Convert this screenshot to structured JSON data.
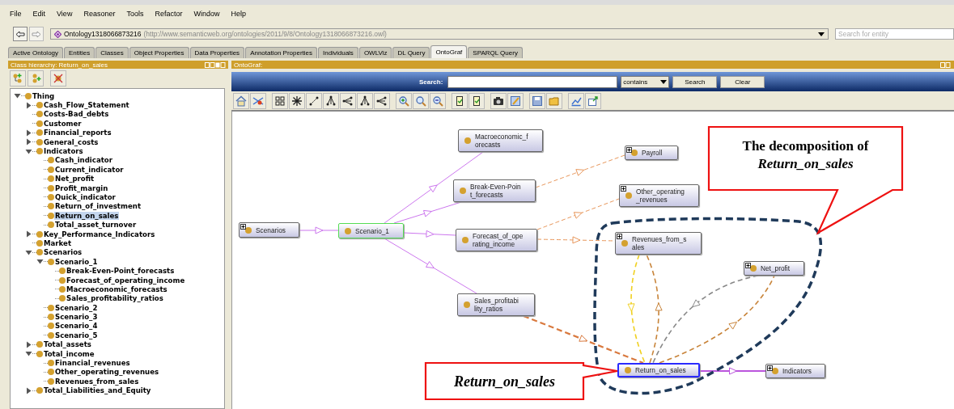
{
  "menu": [
    "File",
    "Edit",
    "View",
    "Reasoner",
    "Tools",
    "Refactor",
    "Window",
    "Help"
  ],
  "address": {
    "ontology": "Ontology1318066873216",
    "iri": "(http://www.semanticweb.org/ontologies/2011/9/8/Ontology1318066873216.owl)"
  },
  "entity_search": {
    "placeholder": "Search for entity"
  },
  "tabs": [
    {
      "label": "Active Ontology",
      "selected": false
    },
    {
      "label": "Entities",
      "selected": false
    },
    {
      "label": "Classes",
      "selected": false
    },
    {
      "label": "Object Properties",
      "selected": false
    },
    {
      "label": "Data Properties",
      "selected": false
    },
    {
      "label": "Annotation Properties",
      "selected": false
    },
    {
      "label": "Individuals",
      "selected": false
    },
    {
      "label": "OWLViz",
      "selected": false
    },
    {
      "label": "DL Query",
      "selected": false
    },
    {
      "label": "OntoGraf",
      "selected": true
    },
    {
      "label": "SPARQL Query",
      "selected": false
    }
  ],
  "class_hierarchy": {
    "title": "Class hierarchy: Return_on_sales",
    "tree": [
      {
        "label": "Thing",
        "expanded": true,
        "selected": false,
        "children": [
          {
            "label": "Cash_Flow_Statement",
            "expanded": false,
            "selected": false
          },
          {
            "label": "Costs-Bad_debts",
            "selected": false
          },
          {
            "label": "Customer",
            "selected": false
          },
          {
            "label": "Financial_reports",
            "expanded": false,
            "selected": false
          },
          {
            "label": "General_costs",
            "expanded": false,
            "selected": false
          },
          {
            "label": "Indicators",
            "expanded": true,
            "selected": false,
            "children": [
              {
                "label": "Cash_indicator",
                "selected": false
              },
              {
                "label": "Current_indicator",
                "selected": false
              },
              {
                "label": "Net_profit",
                "selected": false
              },
              {
                "label": "Profit_margin",
                "selected": false
              },
              {
                "label": "Quick_indicator",
                "selected": false
              },
              {
                "label": "Return_of_investment",
                "selected": false
              },
              {
                "label": "Return_on_sales",
                "selected": true
              },
              {
                "label": "Total_asset_turnover",
                "selected": false
              }
            ]
          },
          {
            "label": "Key_Performance_Indicators",
            "expanded": false,
            "selected": false
          },
          {
            "label": "Market",
            "selected": false
          },
          {
            "label": "Scenarios",
            "expanded": true,
            "selected": false,
            "children": [
              {
                "label": "Scenario_1",
                "expanded": true,
                "selected": false,
                "children": [
                  {
                    "label": "Break-Even-Point_forecasts",
                    "selected": false
                  },
                  {
                    "label": "Forecast_of_operating_income",
                    "selected": false
                  },
                  {
                    "label": "Macroeconomic_forecasts",
                    "selected": false
                  },
                  {
                    "label": "Sales_profitability_ratios",
                    "selected": false
                  }
                ]
              },
              {
                "label": "Scenario_2",
                "selected": false
              },
              {
                "label": "Scenario_3",
                "selected": false
              },
              {
                "label": "Scenario_4",
                "selected": false
              },
              {
                "label": "Scenario_5",
                "selected": false
              }
            ]
          },
          {
            "label": "Total_assets",
            "expanded": false,
            "selected": false
          },
          {
            "label": "Total_income",
            "expanded": true,
            "selected": false,
            "children": [
              {
                "label": "Financial_revenues",
                "selected": false
              },
              {
                "label": "Other_operating_revenues",
                "selected": false
              },
              {
                "label": "Revenues_from_sales",
                "selected": false
              }
            ]
          },
          {
            "label": "Total_Liabilities_and_Equity",
            "expanded": false,
            "selected": false
          }
        ]
      }
    ]
  },
  "ontograf": {
    "title": "OntoGraf:",
    "search_label": "Search:",
    "search_mode": "contains",
    "buttons": [
      "Search",
      "Clear"
    ],
    "nodes": [
      {
        "lines": [
          "Scenarios"
        ],
        "expandable": true,
        "selected": false,
        "highlighted": false
      },
      {
        "lines": [
          "Scenario_1"
        ],
        "expandable": false,
        "selected": false,
        "highlighted": true
      },
      {
        "lines": [
          "Macroeconomic_f",
          "orecasts"
        ],
        "expandable": false,
        "selected": false,
        "highlighted": false
      },
      {
        "lines": [
          "Break-Even-Poin",
          "t_forecasts"
        ],
        "expandable": false,
        "selected": false,
        "highlighted": false
      },
      {
        "lines": [
          "Payroll"
        ],
        "expandable": true,
        "selected": false,
        "highlighted": false
      },
      {
        "lines": [
          "Other_operating",
          "_revenues"
        ],
        "expandable": true,
        "selected": false,
        "highlighted": false
      },
      {
        "lines": [
          "Forecast_of_ope",
          "rating_income"
        ],
        "expandable": false,
        "selected": false,
        "highlighted": false
      },
      {
        "lines": [
          "Revenues_from_s",
          "ales"
        ],
        "expandable": true,
        "selected": false,
        "highlighted": false
      },
      {
        "lines": [
          "Net_profit"
        ],
        "expandable": true,
        "selected": false,
        "highlighted": false
      },
      {
        "lines": [
          "Sales_profitabi",
          "lity_ratios"
        ],
        "expandable": false,
        "selected": false,
        "highlighted": false
      },
      {
        "lines": [
          "Return_on_sales"
        ],
        "expandable": false,
        "selected": true,
        "highlighted": false
      },
      {
        "lines": [
          "Indicators"
        ],
        "expandable": true,
        "selected": false,
        "highlighted": false
      }
    ],
    "callouts": [
      "The decomposition of *Return_on_sales*",
      "Return_on_sales"
    ]
  }
}
